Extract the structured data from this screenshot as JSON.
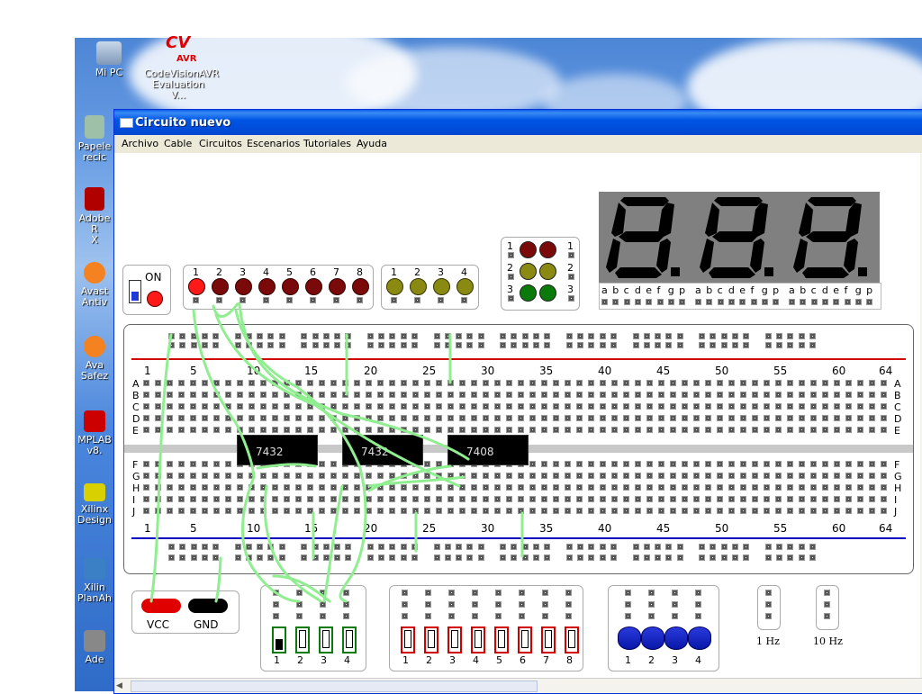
{
  "desktop": {
    "icons": [
      {
        "name": "my-pc",
        "label": "Mi PC"
      },
      {
        "name": "codevision",
        "label1": "CodeVisionAVR",
        "label2": "Evaluation V...",
        "logo": "CV",
        "logo_sub": "AVR"
      },
      {
        "name": "recycle",
        "label1": "Papele",
        "label2": "recic"
      },
      {
        "name": "adobe",
        "label1": "Adobe R",
        "label2": "X"
      },
      {
        "name": "avast",
        "label1": "Avast",
        "label2": "Antiv"
      },
      {
        "name": "avast2",
        "label1": "Ava",
        "label2": "Safez"
      },
      {
        "name": "mplab",
        "label1": "MPLAB",
        "label2": "v8."
      },
      {
        "name": "xilinx",
        "label1": "Xilinx",
        "label2": "Design"
      },
      {
        "name": "xilinx-plan",
        "label1": "Xilin",
        "label2": "PlanAh"
      },
      {
        "name": "ade",
        "label1": "Ade",
        "label2": ""
      }
    ]
  },
  "window": {
    "title": "Circuito nuevo",
    "menu": [
      "Archivo",
      "Cable",
      "Circuitos",
      "Escenarios",
      "Tutoriales",
      "Ayuda"
    ]
  },
  "power": {
    "label": "ON"
  },
  "leds_red": {
    "labels": [
      "1",
      "2",
      "3",
      "4",
      "5",
      "6",
      "7",
      "8"
    ]
  },
  "leds_yellow": {
    "labels": [
      "1",
      "2",
      "3",
      "4"
    ]
  },
  "traffic": {
    "labels": [
      "1",
      "2",
      "3"
    ]
  },
  "seg7": {
    "pins": [
      "a",
      "b",
      "c",
      "d",
      "e",
      "f",
      "g",
      "p"
    ]
  },
  "breadboard": {
    "col_labels": [
      "1",
      "5",
      "10",
      "15",
      "20",
      "25",
      "30",
      "35",
      "40",
      "45",
      "50",
      "55",
      "60",
      "64"
    ],
    "rows_top": [
      "A",
      "B",
      "C",
      "D",
      "E"
    ],
    "rows_bottom": [
      "F",
      "G",
      "H",
      "I",
      "J"
    ],
    "chips": [
      "7432",
      "7432",
      "7408"
    ]
  },
  "supply": {
    "vcc": "VCC",
    "gnd": "GND"
  },
  "switches_green": {
    "labels": [
      "1",
      "2",
      "3",
      "4"
    ]
  },
  "switches_red": {
    "labels": [
      "1",
      "2",
      "3",
      "4",
      "5",
      "6",
      "7",
      "8"
    ]
  },
  "buttons_blue": {
    "labels": [
      "1",
      "2",
      "3",
      "4"
    ]
  },
  "clocks": [
    "1 Hz",
    "10 Hz"
  ],
  "colors": {
    "red_led": "#7a0a0a",
    "red_led_on": "#ff1a1a",
    "yellow_led": "#8a8a12",
    "green_led": "#0a7a0a",
    "wire": "#90ee90",
    "rail_red": "#d00000",
    "rail_blue": "#0000c0"
  }
}
